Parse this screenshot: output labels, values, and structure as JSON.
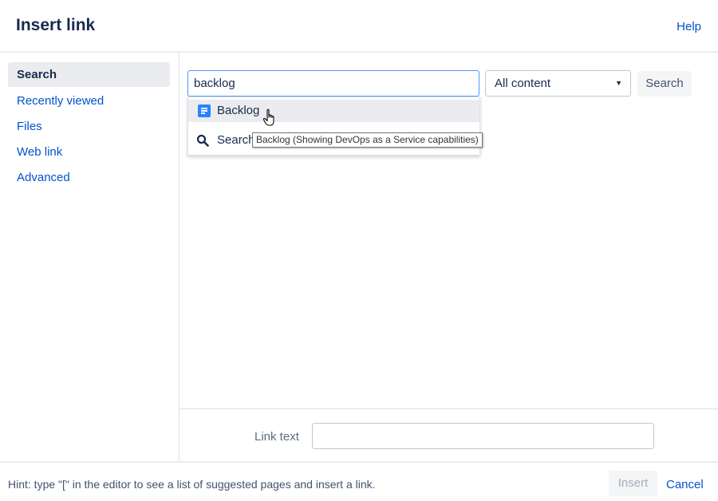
{
  "dialog": {
    "title": "Insert link",
    "help_label": "Help"
  },
  "sidebar": {
    "items": [
      {
        "label": "Search",
        "active": true
      },
      {
        "label": "Recently viewed",
        "active": false
      },
      {
        "label": "Files",
        "active": false
      },
      {
        "label": "Web link",
        "active": false
      },
      {
        "label": "Advanced",
        "active": false
      }
    ]
  },
  "search": {
    "query": "backlog",
    "scope_selected": "All content",
    "button_label": "Search",
    "suggestions": [
      {
        "label": "Backlog",
        "icon": "page-icon"
      },
      {
        "label": "Search",
        "icon": "search-icon"
      }
    ],
    "tooltip": "Backlog (Showing DevOps as a Service capabilities)"
  },
  "link_text": {
    "label": "Link text",
    "value": ""
  },
  "footer": {
    "hint": "Hint: type \"[\" in the editor to see a list of suggested pages and insert a link.",
    "insert_label": "Insert",
    "cancel_label": "Cancel"
  },
  "colors": {
    "accent": "#0052cc",
    "focus_border": "#4c9aff",
    "page_icon": "#2684ff"
  }
}
